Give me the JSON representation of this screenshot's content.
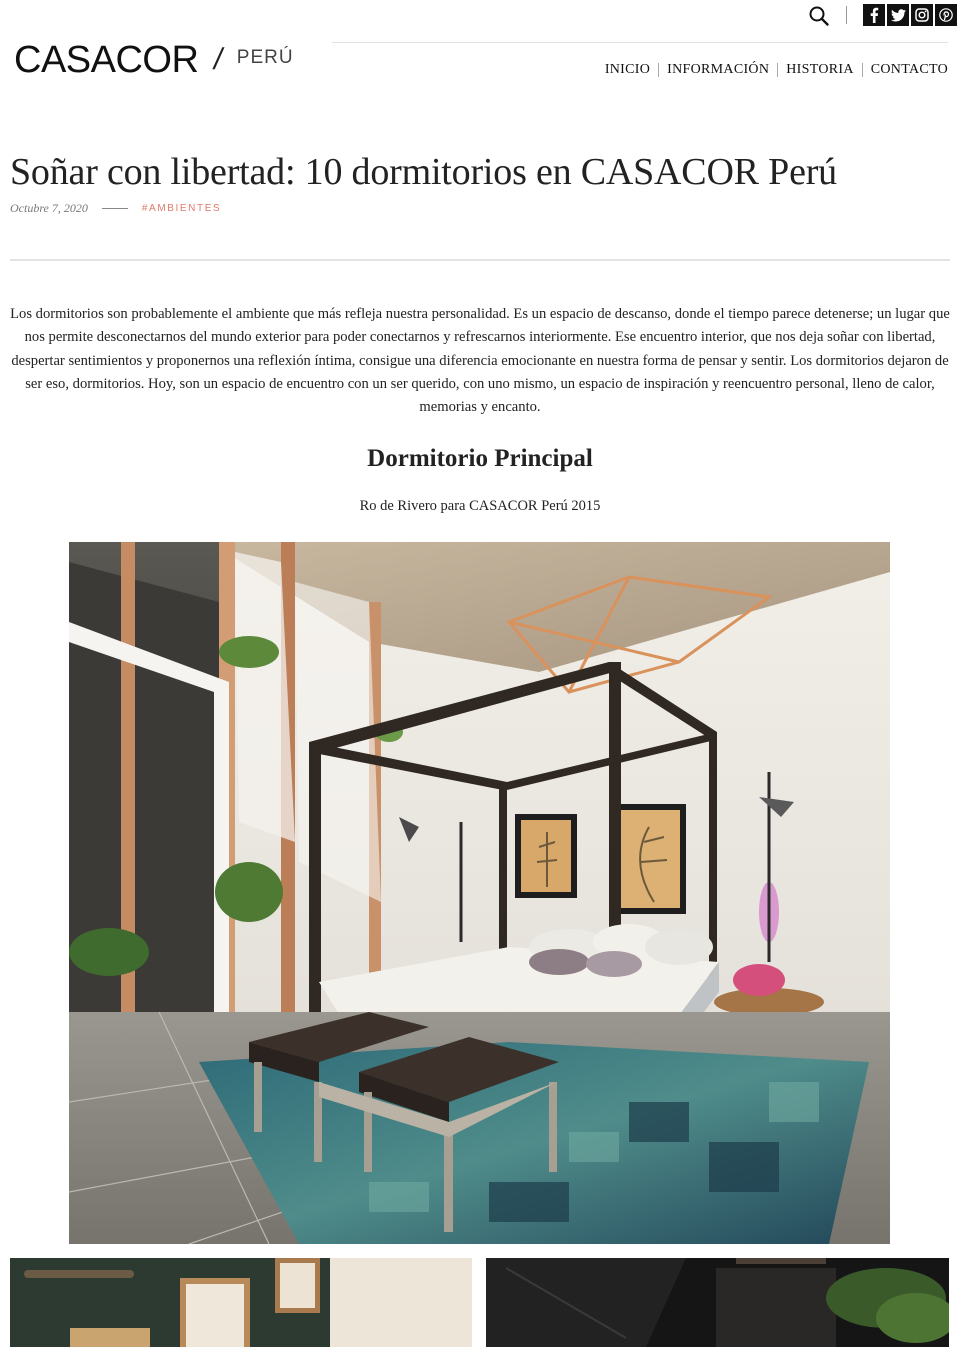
{
  "header": {
    "logo": {
      "brand": "CASACOR",
      "separator": "/",
      "country": "PERÚ"
    },
    "search_icon": "search-icon",
    "socials": [
      {
        "name": "facebook",
        "glyph": "f"
      },
      {
        "name": "twitter",
        "glyph": "t"
      },
      {
        "name": "instagram",
        "glyph": "ig"
      },
      {
        "name": "pinterest",
        "glyph": "p"
      }
    ],
    "nav": [
      "INICIO",
      "INFORMACIÓN",
      "HISTORIA",
      "CONTACTO"
    ]
  },
  "article": {
    "title": "Soñar con libertad: 10 dormitorios en CASACOR Perú",
    "date": "Octubre 7, 2020",
    "tag": "#AMBIENTES",
    "intro": "Los dormitorios son probablemente el ambiente que más refleja nuestra personalidad. Es un espacio de descanso, donde el tiempo parece detenerse; un lugar que nos permite desconectarnos del mundo exterior para poder conectarnos y refrescarnos interiormente. Ese encuentro interior, que nos deja soñar con libertad, despertar sentimientos y proponernos una reflexión íntima, consigue una diferencia emocionante en nuestra forma de pensar y sentir. Los dormitorios dejaron de ser eso, dormitorios. Hoy, son un espacio de encuentro con un ser querido, con uno mismo, un espacio de inspiración y reencuentro personal, lleno de calor, memorias y encanto.",
    "section_title": "Dormitorio Principal",
    "section_caption": "Ro de Rivero para CASACOR Perú 2015"
  },
  "colors": {
    "accent_tag": "#e07a6b",
    "text": "#222222",
    "social_bg": "#111111"
  }
}
